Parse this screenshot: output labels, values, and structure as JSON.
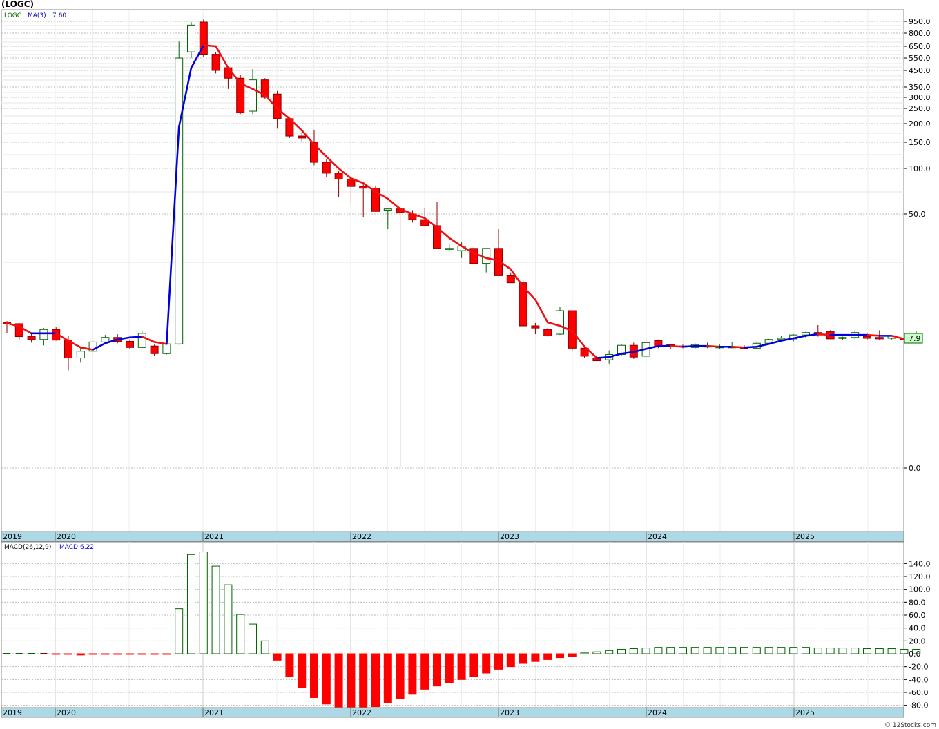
{
  "title": "(LOGC)",
  "credit": "© 12Stocks.com",
  "main_legend": {
    "ticker": "LOGC",
    "ma_label": "MA(3)",
    "ma_value": "7.60"
  },
  "macd_legend": {
    "label": "MACD(26,12,9)",
    "value": "MACD:6.22"
  },
  "last_price_label": "7.9",
  "colors": {
    "up": "#006400",
    "down": "#ff0000",
    "ma_up": "#0000dd",
    "ma_down": "#ee1111",
    "axis_band": "#add8e6"
  },
  "price_axis_ticks": [
    "950.0",
    "800.0",
    "650.0",
    "550.0",
    "450.0",
    "350.0",
    "300.0",
    "250.0",
    "200.0",
    "150.0",
    "100.0",
    "50.0",
    "0.0"
  ],
  "macd_axis_ticks": [
    "140.0",
    "120.0",
    "100.0",
    "80.0",
    "60.0",
    "40.0",
    "20.0",
    "0.0",
    "-20.0",
    "-40.0",
    "-60.0",
    "-80.0"
  ],
  "year_labels": [
    "2019",
    "2020",
    "2021",
    "2022",
    "2023",
    "2024",
    "2025"
  ],
  "chart_data": [
    {
      "type": "candlestick",
      "title": "(LOGC)",
      "yscale": "log",
      "frequency": "monthly",
      "start": "2019-12",
      "series_name": "LOGC",
      "candles": [
        [
          10,
          10.2,
          8.5,
          9.8
        ],
        [
          9.8,
          9.9,
          7.6,
          8.1
        ],
        [
          8.1,
          8.5,
          7.2,
          7.7
        ],
        [
          7.7,
          9.2,
          6.8,
          9.0
        ],
        [
          9.0,
          9.3,
          7.5,
          7.6
        ],
        [
          7.6,
          8.2,
          4.0,
          5.2
        ],
        [
          5.2,
          6.6,
          4.7,
          6.0
        ],
        [
          6.0,
          7.5,
          5.8,
          7.3
        ],
        [
          7.3,
          8.3,
          7.0,
          8.0
        ],
        [
          8.0,
          8.4,
          7.1,
          7.4
        ],
        [
          7.4,
          7.7,
          6.3,
          6.5
        ],
        [
          6.5,
          8.8,
          6.4,
          8.5
        ],
        [
          6.7,
          6.9,
          5.4,
          5.7
        ],
        [
          5.7,
          7.2,
          5.6,
          7.0
        ],
        [
          7.0,
          700,
          6.9,
          550
        ],
        [
          600,
          940,
          550,
          900
        ],
        [
          940,
          980,
          560,
          580
        ],
        [
          580,
          600,
          430,
          450
        ],
        [
          470,
          480,
          340,
          400
        ],
        [
          400,
          420,
          230,
          235
        ],
        [
          240,
          460,
          230,
          390
        ],
        [
          390,
          400,
          290,
          300
        ],
        [
          315,
          330,
          185,
          215
        ],
        [
          215,
          220,
          160,
          165
        ],
        [
          165,
          175,
          150,
          160
        ],
        [
          150,
          180,
          105,
          110
        ],
        [
          110,
          115,
          88,
          93
        ],
        [
          93,
          96,
          65,
          85
        ],
        [
          85,
          88,
          58,
          76
        ],
        [
          76,
          80,
          48,
          74
        ],
        [
          74,
          77,
          52,
          52
        ],
        [
          53,
          54,
          40,
          54
        ],
        [
          54,
          55,
          0.5,
          51
        ],
        [
          50,
          53,
          44,
          46
        ],
        [
          46,
          55,
          43,
          42
        ],
        [
          42,
          60,
          39,
          30
        ],
        [
          30,
          32,
          29,
          30
        ],
        [
          29,
          33,
          26,
          31
        ],
        [
          30,
          31,
          25,
          24
        ],
        [
          24,
          30,
          21,
          30
        ],
        [
          30,
          40,
          21,
          20
        ],
        [
          20,
          21,
          19,
          18
        ],
        [
          18,
          19,
          9.5,
          9.5
        ],
        [
          9.5,
          9.9,
          8.4,
          9.2
        ],
        [
          9.0,
          9.2,
          8.1,
          8.2
        ],
        [
          8.4,
          12.6,
          8.3,
          11.9
        ],
        [
          11.9,
          11.9,
          6.1,
          6.4
        ],
        [
          6.4,
          6.8,
          5.2,
          5.4
        ],
        [
          5.2,
          5.5,
          4.8,
          4.9
        ],
        [
          5.0,
          6.1,
          4.6,
          5.6
        ],
        [
          5.6,
          7.0,
          5.4,
          6.8
        ],
        [
          6.8,
          7.2,
          5.1,
          5.3
        ],
        [
          5.4,
          7.6,
          5.2,
          7.2
        ],
        [
          7.5,
          7.7,
          6.4,
          6.6
        ],
        [
          6.9,
          7.0,
          6.3,
          6.7
        ],
        [
          6.7,
          6.9,
          6.4,
          6.6
        ],
        [
          6.5,
          7.1,
          6.3,
          6.9
        ],
        [
          6.7,
          7.2,
          6.4,
          6.7
        ],
        [
          6.6,
          6.9,
          6.3,
          6.6
        ],
        [
          6.6,
          7.3,
          6.4,
          6.6
        ],
        [
          6.5,
          6.8,
          6.3,
          6.4
        ],
        [
          6.4,
          7.2,
          6.3,
          7.1
        ],
        [
          7.1,
          7.8,
          7.0,
          7.7
        ],
        [
          7.7,
          8.2,
          7.5,
          7.9
        ],
        [
          7.8,
          8.4,
          7.4,
          8.3
        ],
        [
          8.3,
          8.7,
          8.0,
          8.6
        ],
        [
          8.6,
          9.6,
          8.1,
          8.3
        ],
        [
          8.7,
          8.9,
          7.8,
          7.8
        ],
        [
          7.9,
          8.1,
          7.6,
          8.0
        ],
        [
          8.0,
          8.9,
          7.8,
          8.6
        ],
        [
          8.1,
          8.5,
          7.7,
          7.9
        ],
        [
          8.0,
          8.9,
          7.6,
          7.8
        ],
        [
          7.9,
          8.3,
          7.7,
          8.2
        ],
        [
          7.9,
          8.0,
          7.6,
          7.8
        ],
        [
          7.8,
          8.7,
          7.7,
          8.5
        ]
      ],
      "ma3": [
        9.9,
        9.4,
        8.5,
        8.5,
        8.5,
        7.5,
        6.5,
        6.2,
        7.1,
        7.7,
        8.0,
        8.1,
        7.3,
        7.0,
        190,
        470,
        660,
        650,
        470,
        370,
        340,
        310,
        250,
        215,
        180,
        145,
        120,
        100,
        86,
        80,
        70,
        63,
        54,
        50,
        47,
        41,
        35,
        31,
        28,
        26,
        25,
        22,
        17,
        14,
        10,
        9.5,
        8.8,
        6.6,
        5.2,
        5.3,
        5.7,
        5.9,
        6.3,
        6.7,
        6.7,
        6.6,
        6.7,
        6.7,
        6.6,
        6.6,
        6.5,
        6.6,
        7.0,
        7.5,
        7.9,
        8.2,
        8.4,
        8.3,
        8.3,
        8.3,
        8.3,
        8.2,
        8.2,
        7.8,
        7.6
      ],
      "xlabel": "",
      "ylabel": ""
    },
    {
      "type": "bar",
      "title": "MACD(26,12,9)",
      "series_name": "MACD",
      "values": [
        0,
        0,
        0,
        -0.5,
        -1,
        -1,
        -2,
        -1,
        -1,
        -1,
        -1,
        -1,
        -1,
        -1,
        70,
        154,
        158,
        136,
        107,
        61,
        46,
        20,
        -10,
        -35,
        -53,
        -68,
        -78,
        -84,
        -86,
        -85,
        -82,
        -76,
        -70,
        -63,
        -55,
        -50,
        -45,
        -40,
        -35,
        -30,
        -24,
        -20,
        -15,
        -12,
        -9,
        -6,
        -4,
        2,
        3,
        5,
        7,
        8,
        9,
        10,
        10,
        10,
        10,
        10,
        10,
        10,
        10,
        10,
        10,
        10,
        10,
        10,
        9,
        9,
        9,
        9,
        8,
        8,
        8,
        7,
        7
      ],
      "ylim": [
        -85,
        158
      ]
    }
  ]
}
